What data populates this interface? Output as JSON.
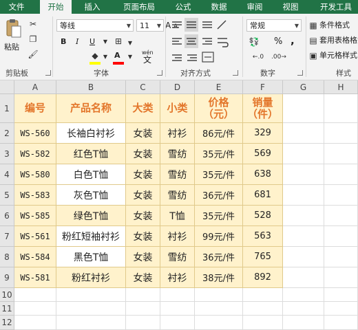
{
  "tabs": [
    "文件",
    "开始",
    "插入",
    "页面布局",
    "公式",
    "数据",
    "审阅",
    "视图",
    "开发工具"
  ],
  "active_tab": "开始",
  "ribbon": {
    "clipboard": {
      "label": "剪贴板",
      "paste": "粘贴"
    },
    "font": {
      "label": "字体",
      "name": "等线",
      "size": "11",
      "bold": "B",
      "italic": "I",
      "underline": "U",
      "grow": "A",
      "shrink": "A",
      "phonetic": "wén",
      "phonetic_char": "文"
    },
    "alignment": {
      "label": "对齐方式"
    },
    "number": {
      "label": "数字",
      "format": "常规",
      "percent": "%",
      "comma": ","
    },
    "styles": {
      "label": "样式",
      "conditional": "条件格式",
      "table": "套用表格格式",
      "cell": "单元格样式"
    }
  },
  "columns": [
    "A",
    "B",
    "C",
    "D",
    "E",
    "F",
    "G",
    "H"
  ],
  "rows": [
    "1",
    "2",
    "3",
    "4",
    "5",
    "6",
    "7",
    "8",
    "9",
    "10",
    "11",
    "12"
  ],
  "table": {
    "headers": [
      "编号",
      "产品名称",
      "大类",
      "小类",
      "价格\n（元）",
      "销量\n（件）"
    ],
    "data": [
      [
        "WS-560",
        "长袖白衬衫",
        "女装",
        "衬衫",
        "86元/件",
        "329"
      ],
      [
        "WS-582",
        "红色T恤",
        "女装",
        "雪纺",
        "35元/件",
        "569"
      ],
      [
        "WS-580",
        "白色T恤",
        "女装",
        "雪纺",
        "35元/件",
        "638"
      ],
      [
        "WS-583",
        "灰色T恤",
        "女装",
        "雪纺",
        "36元/件",
        "681"
      ],
      [
        "WS-585",
        "绿色T恤",
        "女装",
        "T恤",
        "35元/件",
        "528"
      ],
      [
        "WS-561",
        "粉红短袖衬衫",
        "女装",
        "衬衫",
        "99元/件",
        "563"
      ],
      [
        "WS-584",
        "黑色T恤",
        "女装",
        "雪纺",
        "36元/件",
        "765"
      ],
      [
        "WS-581",
        "粉红衬衫",
        "女装",
        "衬衫",
        "38元/件",
        "892"
      ]
    ]
  },
  "colors": {
    "header_fill": "#fff2cc",
    "header_text": "#e3762b",
    "accent": "#217346"
  }
}
